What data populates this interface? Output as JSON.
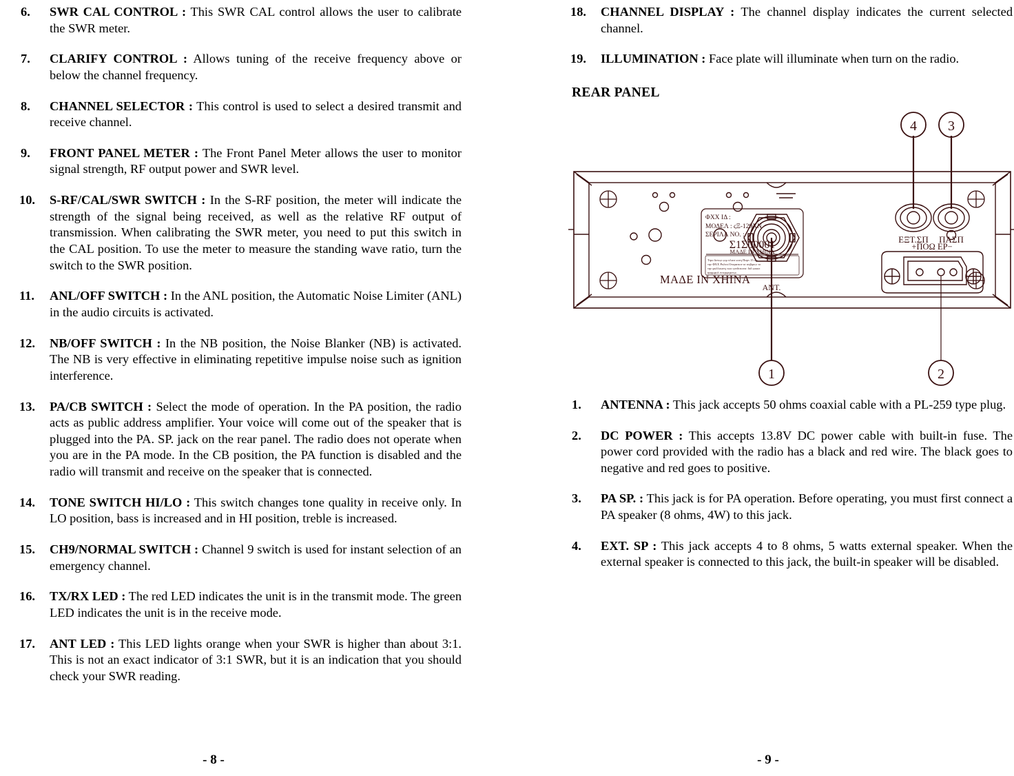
{
  "document": {
    "type": "cb-radio-owners-manual",
    "left_page_folio": "- 8 -",
    "right_page_folio": "- 9 -"
  },
  "left_column": {
    "items": [
      {
        "num": "6.",
        "term": "SWR CAL CONTROL :",
        "body": "This SWR CAL control allows the user to calibrate the SWR meter."
      },
      {
        "num": "7.",
        "term": "CLARIFY CONTROL :",
        "body": "Allows tuning of the receive frequency above or below the channel frequency."
      },
      {
        "num": "8.",
        "term": "CHANNEL SELECTOR :",
        "body": "This control is used to select a desired transmit and receive channel."
      },
      {
        "num": "9.",
        "term": "FRONT PANEL METER :",
        "body": "The Front Panel Meter allows the user to monitor signal strength, RF output power and SWR level."
      },
      {
        "num": "10.",
        "term": "S-RF/CAL/SWR SWITCH :",
        "body": "In the S-RF position, the meter will indicate the strength of the signal being received, as well as the relative RF output of transmission. When calibrating the SWR meter, you need to put this switch in the CAL position. To use the meter to measure the standing wave ratio, turn the switch to the SWR position."
      },
      {
        "num": "11.",
        "term": "ANL/OFF SWITCH :",
        "body": "In the ANL position, the Automatic Noise Limiter (ANL) in the audio circuits is activated."
      },
      {
        "num": "12.",
        "term": "NB/OFF SWITCH :",
        "body": "In the NB position, the Noise Blanker (NB) is activated. The NB is very effective in eliminating repetitive impulse noise such as ignition interference."
      },
      {
        "num": "13.",
        "term": "PA/CB SWITCH :",
        "body": "Select the mode of operation. In the PA position, the radio acts as public address amplifier. Your voice will come out of the speaker that is plugged into the PA. SP. jack on the rear panel. The radio does not operate when you are in the PA mode. In the CB position, the PA function is disabled and the radio will transmit and receive on the speaker that is connected."
      },
      {
        "num": "14.",
        "term": "TONE SWITCH HI/LO :",
        "body": "This switch changes tone quality in receive only. In LO position, bass is increased and in HI position, treble is increased."
      },
      {
        "num": "15.",
        "term": "CH9/NORMAL SWITCH :",
        "body": "Channel 9 switch is used for instant selection of an emergency channel."
      },
      {
        "num": "16.",
        "term": "TX/RX LED :",
        "body": "The red LED indicates the unit is in the transmit mode. The green LED indicates the unit is in the receive mode."
      },
      {
        "num": "17.",
        "term": "ANT LED :",
        "body": "This LED lights orange when your SWR is higher than about 3:1. This is not an exact indicator of 3:1 SWR, but it is an indication that you should check your SWR reading."
      }
    ]
  },
  "right_column": {
    "items_top": [
      {
        "num": "18.",
        "term": "CHANNEL DISPLAY :",
        "body": "The channel display indicates the current selected channel."
      },
      {
        "num": "19.",
        "term": "ILLUMINATION :",
        "body": "Face plate will illuminate when turn on the radio."
      }
    ],
    "section_heading": "REAR PANEL",
    "items_bottom": [
      {
        "num": "1.",
        "term": "ANTENNA :",
        "body": "This jack accepts 50 ohms coaxial cable with a PL-259 type plug."
      },
      {
        "num": "2.",
        "term": "DC POWER :",
        "body": "This accepts 13.8V DC power cable with built-in fuse. The power cord provided with the radio has a black and red wire. The black goes to negative and red goes to positive."
      },
      {
        "num": "3.",
        "term": "PA SP. :",
        "body": "This jack is for PA operation. Before operating, you must first connect a PA speaker (8 ohms, 4W) to this jack."
      },
      {
        "num": "4.",
        "term": "EXT. SP :",
        "body": "This jack accepts 4 to 8 ohms, 5 watts external speaker. When the external speaker is connected to this jack, the built-in speaker will be disabled."
      }
    ]
  },
  "figure": {
    "name": "rear-panel-diagram",
    "line_color": "#3a1010",
    "callouts": [
      {
        "id": "4",
        "label": "4"
      },
      {
        "id": "3",
        "label": "3"
      },
      {
        "id": "1",
        "label": "1"
      },
      {
        "id": "2",
        "label": "2"
      }
    ],
    "panel_labels": {
      "made_in_china": "MAΔE IN XHINA",
      "antenna": "ANT.",
      "ext_speaker": "EΞT.ΣΠ",
      "pa_speaker": "ΠΑΣΠ",
      "dc_power": "+ΠΟΩ EP−"
    },
    "sticker": {
      "line1": "ΦXX IΔ   :",
      "line2": "ΜΟΔΕΛ : ςΞ-129XN",
      "line3": "ΣΕΡΙΛΛ ΝΟ. :",
      "serial": "Σ1Σ00001",
      "origin": "ΜΑΔΕ  IN XHINA",
      "fineprint": [
        "Τηισ δεvιςε ςομ πλιεσ ωιτη Παρτ 15  οφ",
        "τηε ΦΧΧ Ρυλεσ.Οπερατιον ισ συβφεςτ το",
        "τηε φολλοωινγ τωο ςονδιτιονσ: διδ ςαυσε",
        "ηαρμφυλ ιντερφερενςε."
      ]
    }
  }
}
